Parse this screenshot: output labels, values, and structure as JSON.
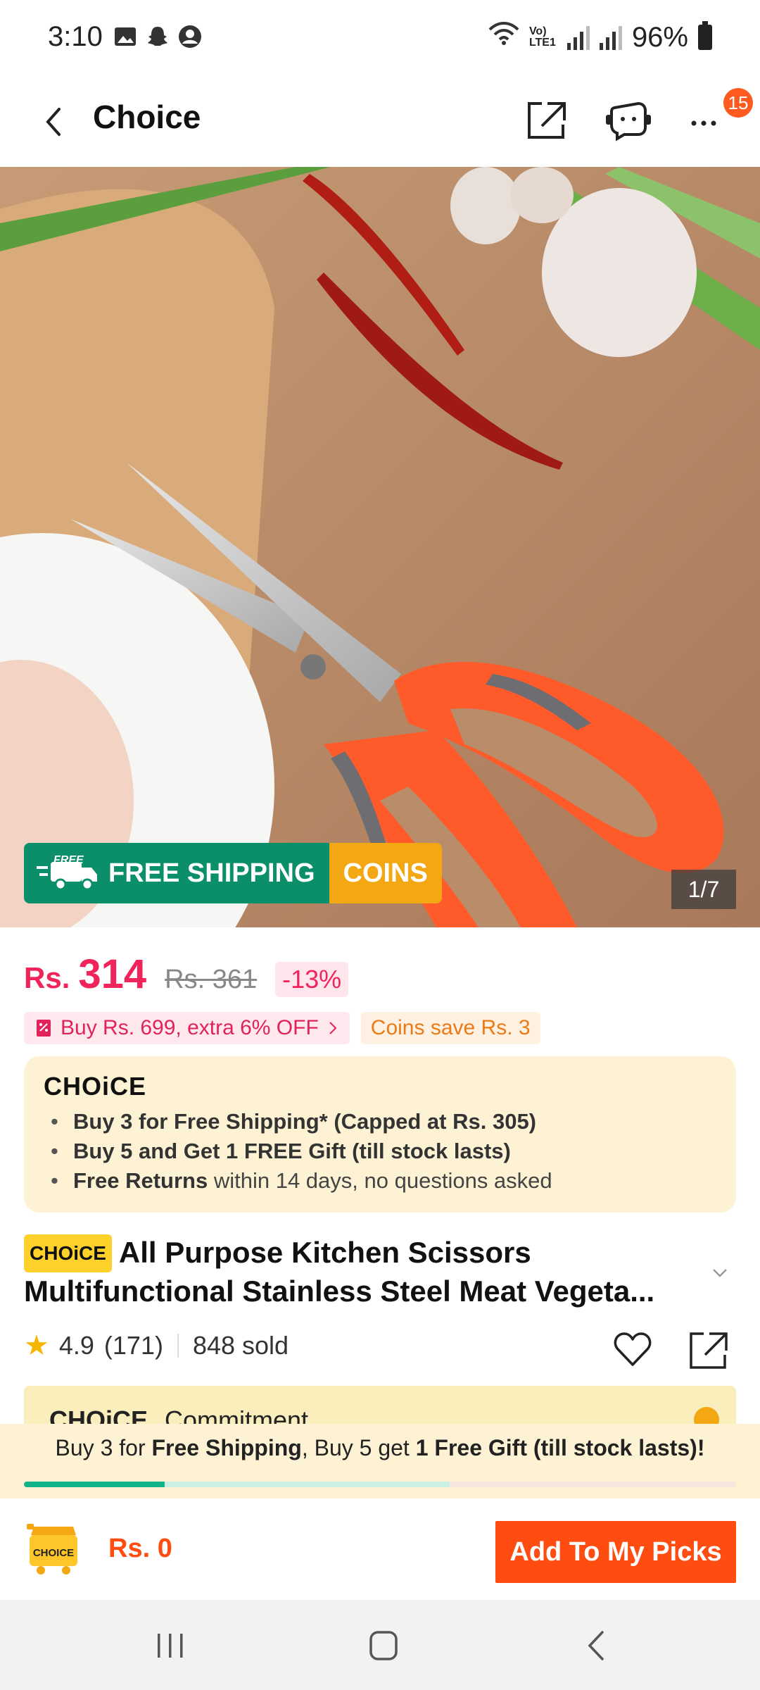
{
  "status_bar": {
    "time": "3:10",
    "network_label": "Vo) LTE1",
    "battery": "96%"
  },
  "header": {
    "title": "Choice",
    "notification_count": "15"
  },
  "product_image": {
    "free_shipping_label": "FREE SHIPPING",
    "free_badge": "FREE",
    "coins_label": "COINS",
    "counter": "1/7"
  },
  "price": {
    "currency": "Rs.",
    "current": "314",
    "original": "Rs. 361",
    "discount": "-13%"
  },
  "promos": {
    "bulk_offer": "Buy Rs. 699, extra 6% OFF",
    "coins_offer": "Coins save Rs. 3"
  },
  "choice_box": {
    "logo": "CHOiCE",
    "items": [
      {
        "bold": "Buy 3 for  Free Shipping* (Capped at Rs. 305)",
        "rest": ""
      },
      {
        "bold": "Buy 5 and Get 1 FREE Gift (till stock lasts)",
        "rest": ""
      },
      {
        "bold": "Free Returns",
        "rest": " within 14 days, no questions asked"
      }
    ]
  },
  "product": {
    "choice_chip": "CHOiCE",
    "title": "All Purpose Kitchen Scissors Multifunctional Stainless Steel Meat Vegeta...",
    "rating": "4.9",
    "reviews": "(171)",
    "sold": "848 sold"
  },
  "commitment": {
    "logo": "CHOiCE",
    "label": "Commitment"
  },
  "bundle": {
    "prefix": "Buy 3 for ",
    "free_shipping": "Free Shipping",
    "middle": ", Buy 5 get ",
    "gift": "1 Free Gift (till stock lasts)!",
    "progress": 0.2
  },
  "bottom_bar": {
    "cart_label": "CHOICE",
    "total": "Rs. 0",
    "add_button": "Add To My Picks"
  },
  "colors": {
    "accent": "#ff4d12",
    "price": "#f0245b",
    "choice_bg": "#fdf3d4",
    "shipping_green": "#0a8f6a",
    "coins_yellow": "#f3a712"
  }
}
